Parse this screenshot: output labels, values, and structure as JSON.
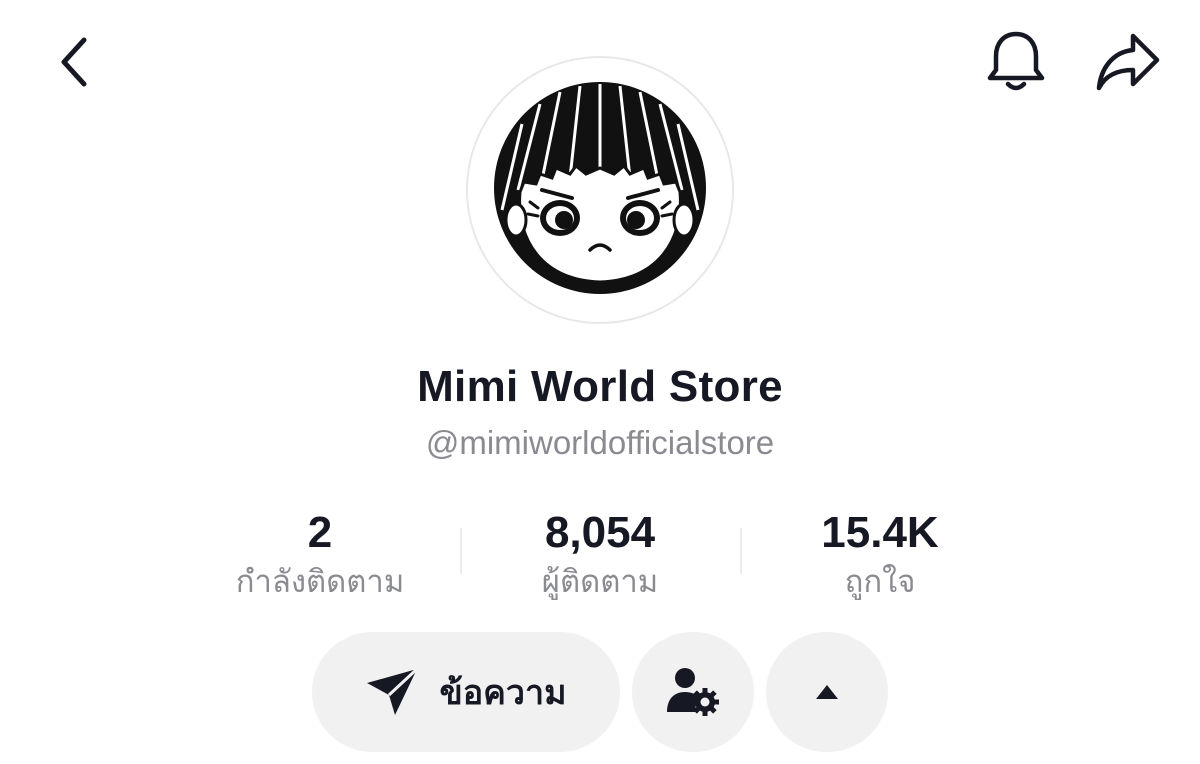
{
  "header": {
    "back_icon": "chevron-left-icon",
    "bell_icon": "bell-icon",
    "share_icon": "share-arrow-icon"
  },
  "profile": {
    "avatar_icon": "girl-face-avatar",
    "display_name": "Mimi World Store",
    "username": "@mimiworldofficialstore"
  },
  "stats": [
    {
      "value": "2",
      "label": "กำลังติดตาม"
    },
    {
      "value": "8,054",
      "label": "ผู้ติดตาม"
    },
    {
      "value": "15.4K",
      "label": "ถูกใจ"
    }
  ],
  "actions": {
    "message_label": "ข้อความ",
    "message_icon": "send-icon",
    "follow_settings_icon": "user-gear-icon",
    "collapse_icon": "caret-up-icon"
  },
  "colors": {
    "primary_text": "#161823",
    "secondary_text": "#8a8b91",
    "button_bg": "#f1f1f2",
    "background": "#ffffff"
  }
}
